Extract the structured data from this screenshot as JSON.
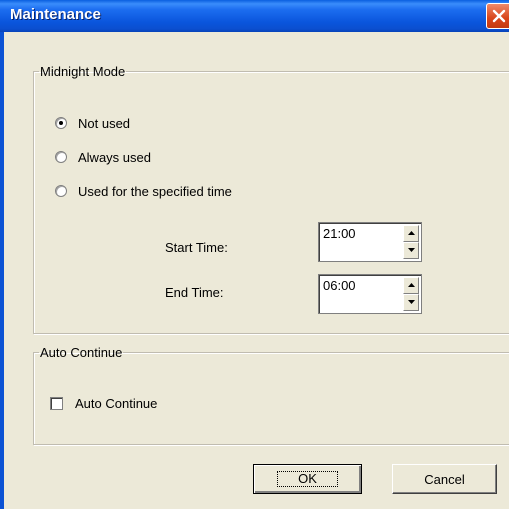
{
  "window": {
    "title": "Maintenance",
    "close_icon": "close-icon",
    "accent_color": "#0a55dc"
  },
  "midnight_mode": {
    "legend": "Midnight Mode",
    "options": [
      {
        "label": "Not used",
        "selected": true
      },
      {
        "label": "Always used",
        "selected": false
      },
      {
        "label": "Used for the specified time",
        "selected": false
      }
    ],
    "start_time": {
      "label": "Start Time:",
      "value": "21:00"
    },
    "end_time": {
      "label": "End Time:",
      "value": "06:00"
    }
  },
  "auto_continue": {
    "legend": "Auto Continue",
    "checkbox_label": "Auto Continue",
    "checked": false
  },
  "buttons": {
    "ok": "OK",
    "cancel": "Cancel"
  }
}
